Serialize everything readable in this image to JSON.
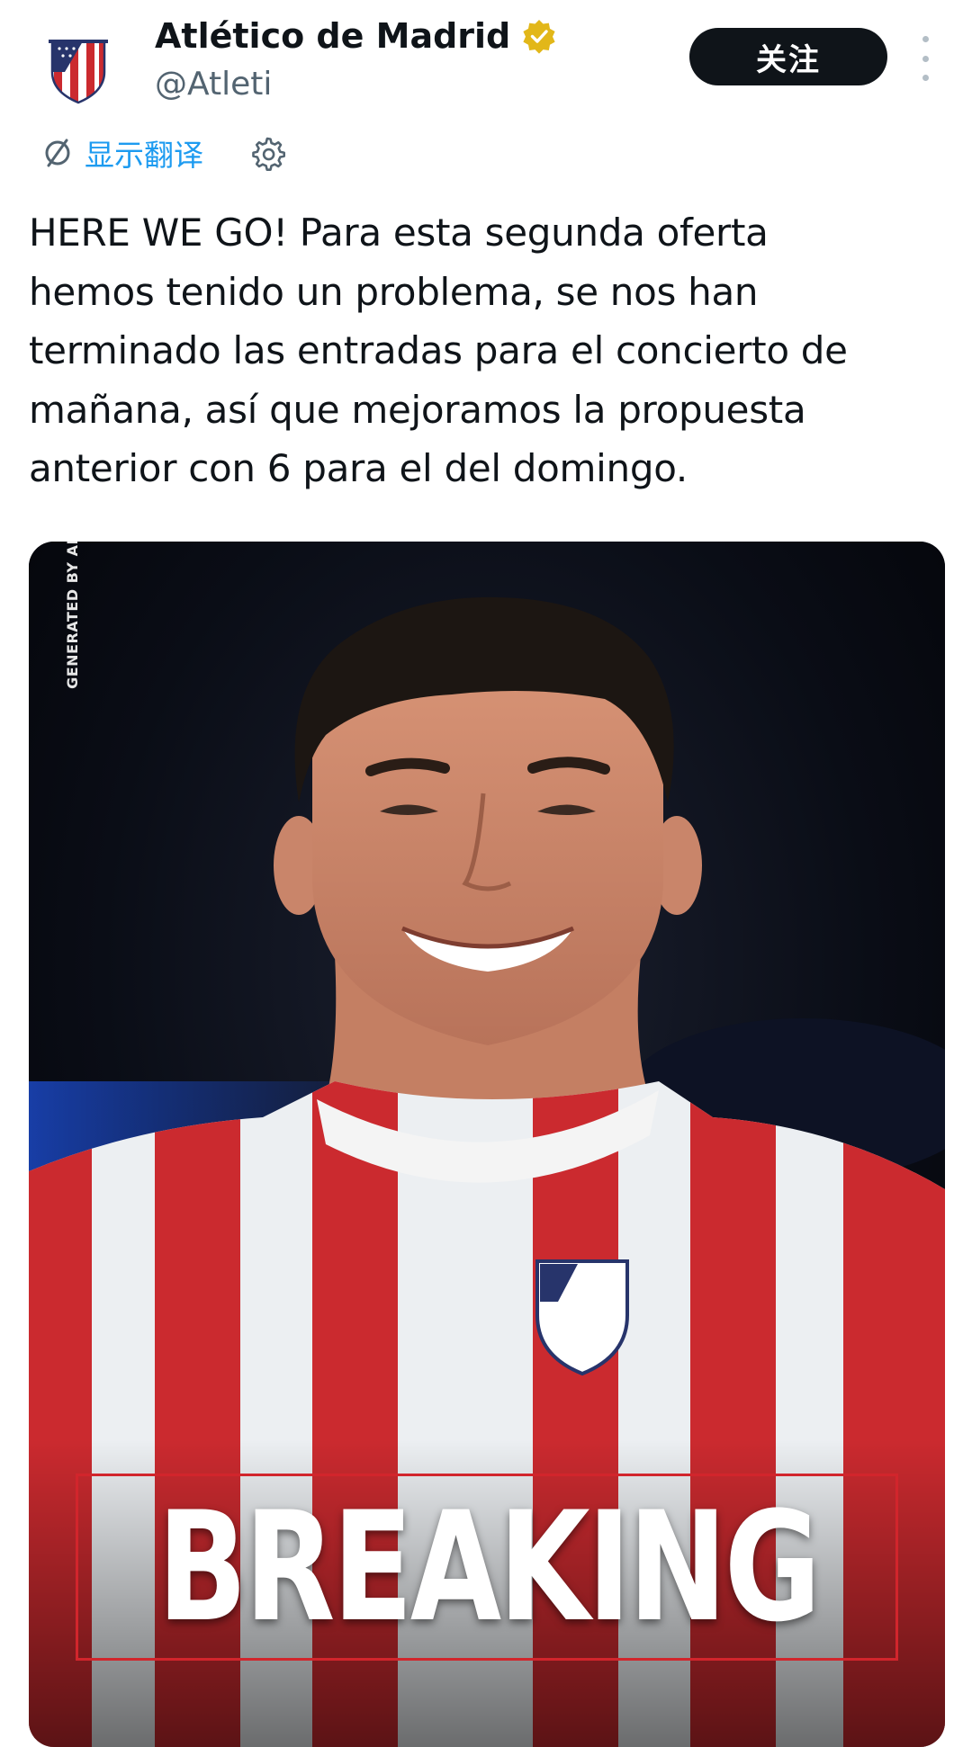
{
  "header": {
    "display_name": "Atlético de Madrid",
    "handle": "@Atleti",
    "follow_label": "关注"
  },
  "translate": {
    "label": "显示翻译"
  },
  "tweet": {
    "lines": [
      "HERE WE GO! Para esta segunda oferta",
      "hemos tenido un problema, se nos han",
      "terminado las entradas para el concierto de",
      "mañana, así que mejoramos la propuesta",
      "anterior con 6 para el del domingo."
    ]
  },
  "media": {
    "watermark": "GENERATED BY AI",
    "headline": "BREAKING"
  },
  "colors": {
    "accent": "#1d9bf0",
    "verified_badge": "#e2b719",
    "follow_button_bg": "#0f1419",
    "club_red": "#cb2a2f"
  }
}
